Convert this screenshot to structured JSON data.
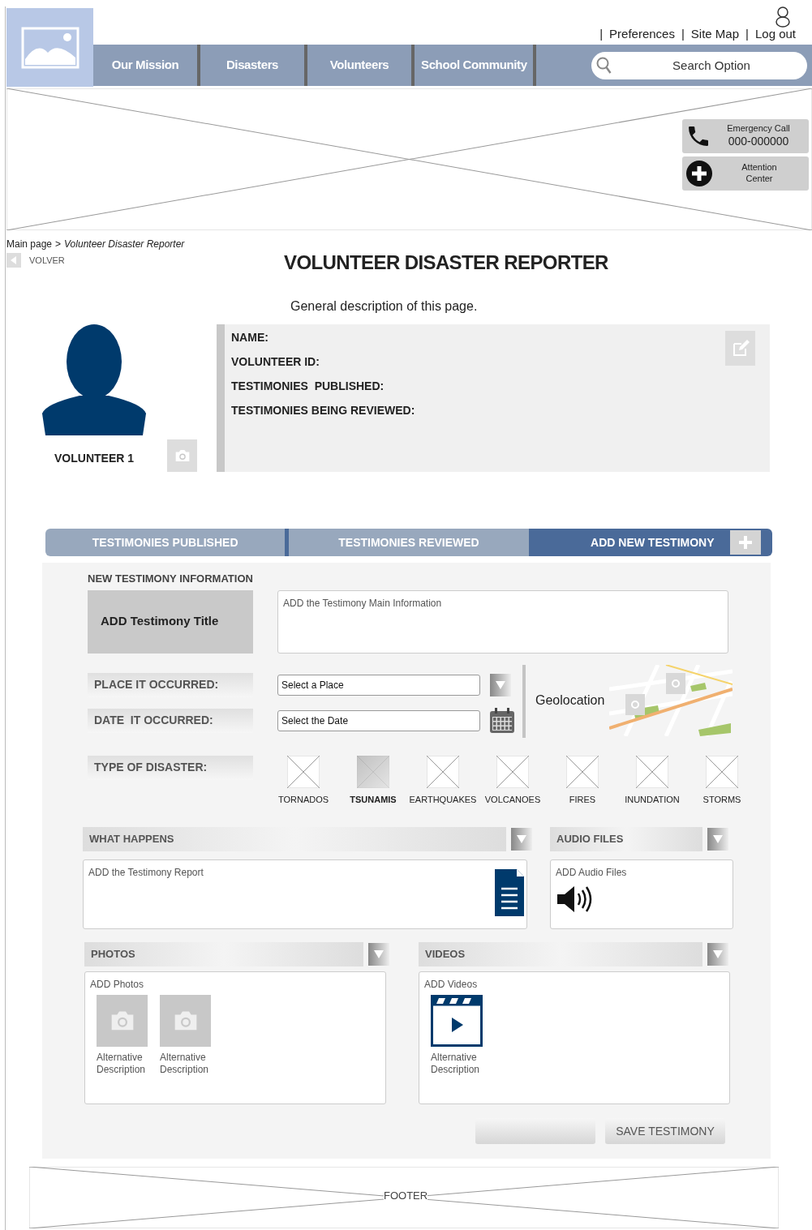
{
  "top_links": [
    "|",
    "Preferences",
    "|",
    "Site Map",
    "|",
    "Log out"
  ],
  "nav": [
    {
      "label": "Our Mission"
    },
    {
      "label": "Disasters"
    },
    {
      "label": "Volunteers"
    },
    {
      "label": "School Community"
    }
  ],
  "search": {
    "placeholder": "Search Option"
  },
  "banner_actions": [
    {
      "kind": "phone",
      "title": "Emergency Call",
      "number": "000-000000"
    },
    {
      "kind": "plus",
      "title": "Attention Center"
    }
  ],
  "breadcrumb": {
    "root": "Main page",
    "separator": ">",
    "current": "Volunteer Disaster Reporter"
  },
  "back": "VOLVER",
  "title": "VOLUNTEER DISASTER REPORTER",
  "description": "General description of this page.",
  "profile": {
    "name": "VOLUNTEER 1",
    "fields": [
      "NAME:",
      "VOLUNTEER ID:",
      "TESTIMONIES  PUBLISHED:",
      "TESTIMONIES BEING REVIEWED:"
    ]
  },
  "tabs": [
    {
      "label": "TESTIMONIES PUBLISHED",
      "selected": false
    },
    {
      "label": "TESTIMONIES REVIEWED",
      "selected": false
    },
    {
      "label": "ADD NEW TESTIMONY",
      "selected": true
    }
  ],
  "form": {
    "heading": "NEW TESTIMONY INFORMATION",
    "title_button": "ADD Testimony Title",
    "main_info": {
      "placeholder": "ADD the Testimony Main Information"
    },
    "place": {
      "label": "PLACE IT OCCURRED:",
      "placeholder": "Select a Place"
    },
    "date": {
      "label": "DATE  IT OCCURRED:",
      "placeholder": "Select the Date"
    },
    "geolocation": "Geolocation",
    "disaster_label": "TYPE OF DISASTER:",
    "disasters": [
      {
        "label": "TORNADOS",
        "selected": false
      },
      {
        "label": "TSUNAMIS",
        "selected": true
      },
      {
        "label": "EARTHQUAKES",
        "selected": false
      },
      {
        "label": "VOLCANOES",
        "selected": false
      },
      {
        "label": "FIRES",
        "selected": false
      },
      {
        "label": "INUNDATION",
        "selected": false
      },
      {
        "label": "STORMS",
        "selected": false
      }
    ],
    "what_happens": {
      "title": "WHAT HAPPENS",
      "placeholder": "ADD the Testimony Report"
    },
    "audio": {
      "title": "AUDIO FILES",
      "hint": "ADD Audio Files"
    },
    "photos": {
      "title": "PHOTOS",
      "hint": "ADD Photos",
      "items": [
        "Alternative Description",
        "Alternative Description"
      ]
    },
    "videos": {
      "title": "VIDEOS",
      "hint": "ADD Videos",
      "items": [
        "Alternative Description"
      ]
    },
    "save": "SAVE TESTIMONY"
  },
  "footer": "FOOTER"
}
